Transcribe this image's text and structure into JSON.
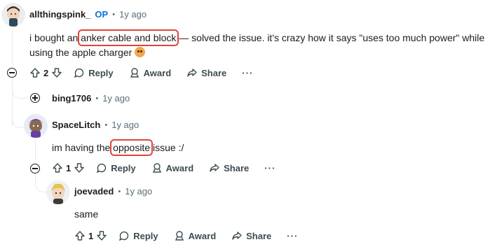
{
  "comments": [
    {
      "username": "allthingspink_",
      "op_badge": "OP",
      "time": "1y ago",
      "body_pre": "i bought an ",
      "body_highlight": "anker cable and block",
      "body_post": " — solved the issue. it's crazy how it says \"uses too much power\" while using the apple charger",
      "votes": "2",
      "reply_label": "Reply",
      "award_label": "Award",
      "share_label": "Share",
      "more_label": "···"
    },
    {
      "username": "bing1706",
      "time": "1y ago",
      "collapsed": true
    },
    {
      "username": "SpaceLitch",
      "time": "1y ago",
      "body_pre": "im having the ",
      "body_highlight": "opposite",
      "body_post": " issue :/",
      "votes": "1",
      "reply_label": "Reply",
      "award_label": "Award",
      "share_label": "Share",
      "more_label": "···"
    },
    {
      "username": "joevaded",
      "time": "1y ago",
      "body": "same",
      "votes": "1",
      "reply_label": "Reply",
      "award_label": "Award",
      "share_label": "Share",
      "more_label": "···"
    }
  ],
  "dot_separator": "•",
  "colors": {
    "highlight_box": "#e0443a",
    "op_badge": "#0a72d6",
    "meta_gray": "#576f76",
    "thread_line": "#e5ebee"
  }
}
